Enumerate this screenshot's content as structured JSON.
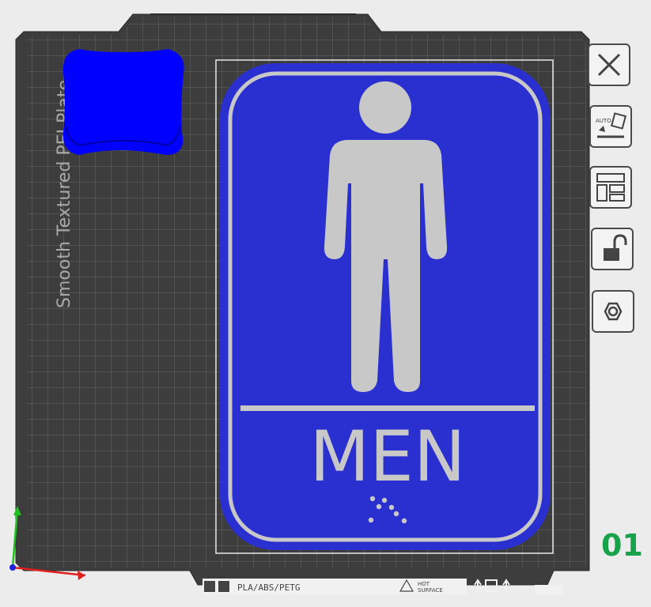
{
  "plate": {
    "label": "Smooth Textured PEI Plate",
    "filament_label": "PLA/ABS/PETG",
    "hot_surface_line1": "HOT",
    "hot_surface_line2": "SURFACE",
    "number": "01",
    "number_color": "#17a34a"
  },
  "sign_model": {
    "text": "MEN",
    "color": "#2a2fd0",
    "print_color": "#c8c8c8",
    "braille_dot_count": 7
  },
  "small_object": {
    "color": "#0000ff"
  },
  "toolbar": {
    "buttons": [
      {
        "name": "close-plate-button",
        "icon": "close-icon",
        "tooltip": ""
      },
      {
        "name": "auto-orient-button",
        "icon": "auto-orient-icon",
        "icon_text": "AUTO"
      },
      {
        "name": "arrange-button",
        "icon": "arrange-icon"
      },
      {
        "name": "lock-plate-button",
        "icon": "unlock-icon"
      },
      {
        "name": "plate-settings-button",
        "icon": "settings-icon"
      }
    ]
  },
  "axes": {
    "x_color": "#e02020",
    "y_color": "#20c020",
    "z_color": "#2020e0"
  }
}
